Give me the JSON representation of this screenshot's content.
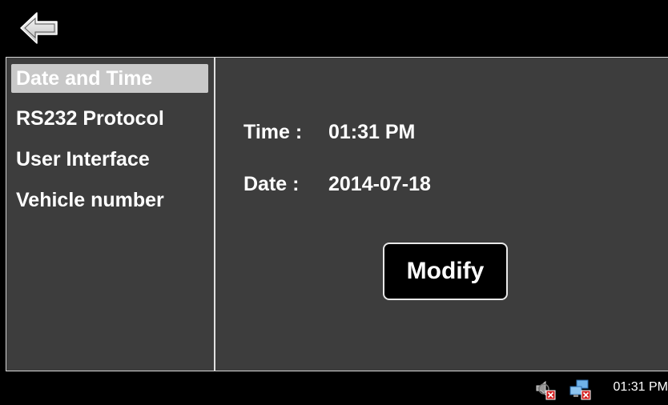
{
  "header": {
    "back_icon": "back-arrow-icon"
  },
  "sidebar": {
    "items": [
      {
        "label": "Date and Time",
        "selected": true
      },
      {
        "label": "RS232 Protocol",
        "selected": false
      },
      {
        "label": "User Interface",
        "selected": false
      },
      {
        "label": "Vehicle number",
        "selected": false
      }
    ]
  },
  "content": {
    "time_label": "Time :",
    "time_value": "01:31 PM",
    "date_label": "Date :",
    "date_value": "2014-07-18",
    "modify_label": "Modify"
  },
  "statusbar": {
    "tray_icons": [
      "speaker-muted-icon",
      "network-disconnected-icon"
    ],
    "clock": "01:31 PM"
  },
  "colors": {
    "panel_bg": "#3d3d3d",
    "selected_bg": "#c8c8c8",
    "bar_bg": "#000000",
    "error_red": "#d42020"
  }
}
